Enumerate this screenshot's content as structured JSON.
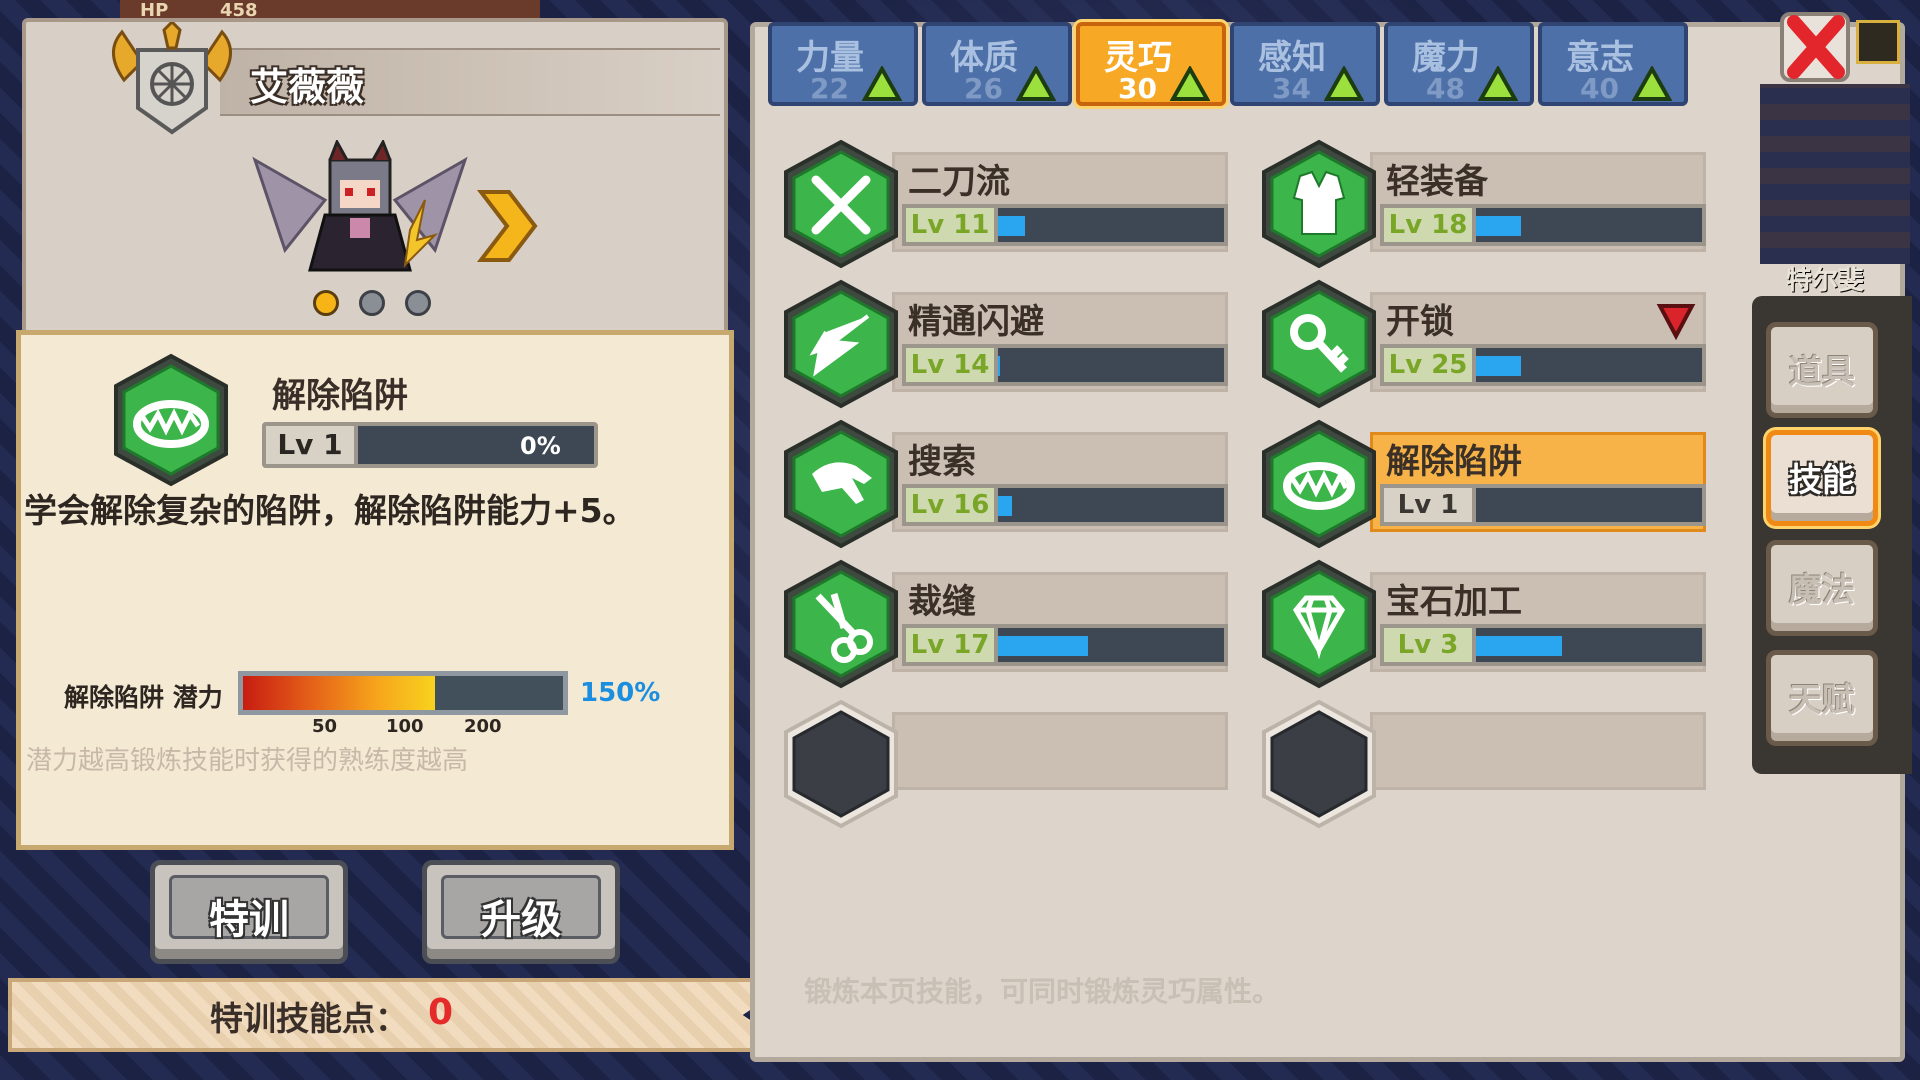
{
  "character": {
    "name": "艾薇薇",
    "page_dots": 3,
    "active_dot": 0
  },
  "top_hud": {
    "hp_label": "HP",
    "hp_value": "458"
  },
  "attribute_tabs": [
    {
      "name": "力量",
      "value": "22"
    },
    {
      "name": "体质",
      "value": "26"
    },
    {
      "name": "灵巧",
      "value": "30",
      "active": true
    },
    {
      "name": "感知",
      "value": "34"
    },
    {
      "name": "魔力",
      "value": "48"
    },
    {
      "name": "意志",
      "value": "40"
    }
  ],
  "skills": [
    {
      "name": "二刀流",
      "level": "Lv 11",
      "progress": 0.12,
      "icon": "crossed-swords-icon"
    },
    {
      "name": "轻装备",
      "level": "Lv 18",
      "progress": 0.2,
      "icon": "vest-icon"
    },
    {
      "name": "精通闪避",
      "level": "Lv 14",
      "progress": 0.01,
      "icon": "dodge-arrow-icon"
    },
    {
      "name": "开锁",
      "level": "Lv 25",
      "progress": 0.2,
      "icon": "key-icon",
      "indicator": "down"
    },
    {
      "name": "搜索",
      "level": "Lv 16",
      "progress": 0.06,
      "icon": "search-hand-icon"
    },
    {
      "name": "解除陷阱",
      "level": "Lv 1",
      "progress": 0,
      "icon": "bear-trap-icon",
      "selected": true
    },
    {
      "name": "裁缝",
      "level": "Lv 17",
      "progress": 0.4,
      "icon": "scissors-icon"
    },
    {
      "name": "宝石加工",
      "level": "Lv 3",
      "progress": 0.38,
      "icon": "gem-icon"
    }
  ],
  "detail": {
    "name": "解除陷阱",
    "level": "Lv 1",
    "percent": "0%",
    "description": "学会解除复杂的陷阱，解除陷阱能力+5。",
    "potential_label": "解除陷阱 潜力",
    "potential_value": "150%",
    "potential_fill": 0.6,
    "ticks": [
      "50",
      "100",
      "200"
    ],
    "potential_note": "潜力越高锻炼技能时获得的熟练度越高"
  },
  "buttons": {
    "train": "特训",
    "upgrade": "升级"
  },
  "training_points": {
    "label": "特训技能点：",
    "value": "0"
  },
  "train_note": "锻炼本页技能，可同时锻炼灵巧属性。",
  "side_menu": [
    {
      "label": "道具"
    },
    {
      "label": "技能",
      "active": true
    },
    {
      "label": "魔法"
    },
    {
      "label": "天赋"
    }
  ],
  "minimap_label": "特尔斐",
  "colors": {
    "accent": "#f7a825",
    "progress": "#2aa6f0",
    "points": "#e52a2a",
    "potential_pct": "#1b8ee0"
  }
}
